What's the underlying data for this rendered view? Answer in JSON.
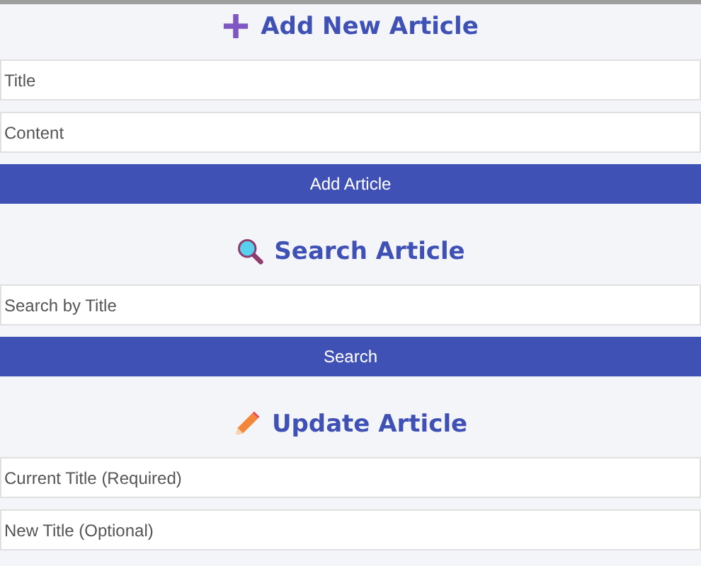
{
  "sections": [
    {
      "kind": "add",
      "title": "Add New Article",
      "fields": [
        {
          "placeholder": "Title"
        },
        {
          "placeholder": "Content"
        }
      ],
      "button": "Add Article"
    },
    {
      "kind": "search",
      "title": "Search Article",
      "fields": [
        {
          "placeholder": "Search by Title"
        }
      ],
      "button": "Search"
    },
    {
      "kind": "update",
      "title": "Update Article",
      "fields": [
        {
          "placeholder": "Current Title (Required)"
        },
        {
          "placeholder": "New Title (Optional)"
        }
      ]
    }
  ]
}
